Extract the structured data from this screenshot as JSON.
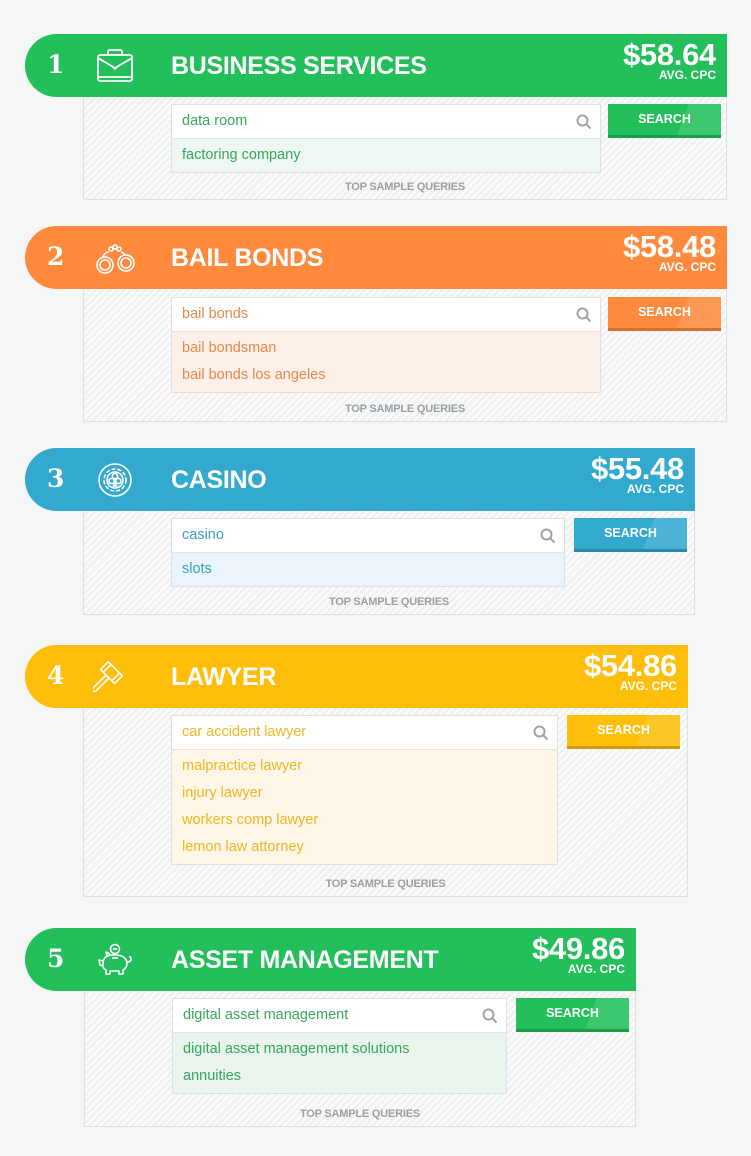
{
  "caption_label": "TOP SAMPLE QUERIES",
  "button_label": "SEARCH",
  "price_label": "AVG. CPC",
  "categories": [
    {
      "rank": "1",
      "title": "BUSINESS SERVICES",
      "icon": "briefcase-icon",
      "price": "$58.64",
      "query": "data room",
      "suggestions": [
        "factoring company"
      ],
      "colors": {
        "primary": "#22bf5a",
        "text": "#35a85c",
        "suggest_bg": "#eef7f1"
      }
    },
    {
      "rank": "2",
      "title": "BAIL BONDS",
      "icon": "handcuffs-icon",
      "price": "$58.48",
      "query": "bail bonds",
      "suggestions": [
        "bail bondsman",
        "bail bonds los angeles"
      ],
      "colors": {
        "primary": "#ff8a3d",
        "text": "#e7894c",
        "suggest_bg": "#fdf0e9"
      }
    },
    {
      "rank": "3",
      "title": "CASINO",
      "icon": "casino-chip-icon",
      "price": "$55.48",
      "query": "casino",
      "suggestions": [
        "slots"
      ],
      "colors": {
        "primary": "#33a9d0",
        "text": "#3aa2c4",
        "suggest_bg": "#eaf4fa"
      }
    },
    {
      "rank": "4",
      "title": "LAWYER",
      "icon": "gavel-icon",
      "price": "$54.86",
      "query": "car accident lawyer",
      "suggestions": [
        "malpractice lawyer",
        "injury lawyer",
        "workers comp lawyer",
        "lemon law attorney"
      ],
      "colors": {
        "primary": "#ffbe0a",
        "text": "#f0b623",
        "suggest_bg": "#fef7e8"
      }
    },
    {
      "rank": "5",
      "title": "ASSET MANAGEMENT",
      "icon": "piggy-bank-icon",
      "price": "$49.86",
      "query": "digital asset management",
      "suggestions": [
        "digital asset management solutions",
        "annuities"
      ],
      "colors": {
        "primary": "#22bf5a",
        "text": "#35a85c",
        "suggest_bg": "#eaf5ee"
      }
    }
  ]
}
